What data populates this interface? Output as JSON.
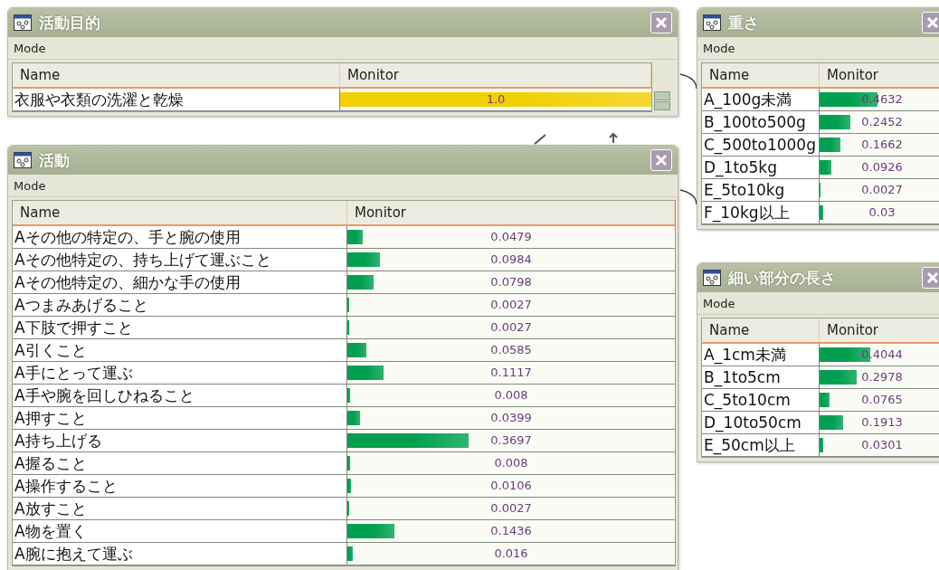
{
  "windows": [
    {
      "title": "活動目的",
      "menu": "Mode",
      "columns": [
        "Name",
        "Monitor"
      ],
      "color": "#f2cf00",
      "scrollbar": true,
      "rows": [
        {
          "name": "衣服や衣類の洗濯と乾燥",
          "value": "1.0",
          "level": 1.0
        }
      ]
    },
    {
      "title": "活動",
      "menu": "Mode",
      "columns": [
        "Name",
        "Monitor"
      ],
      "color": "#00a050",
      "scrollbar": false,
      "rows": [
        {
          "name": "Aその他の特定の、手と腕の使用",
          "value": "0.0479",
          "level": 0.0479
        },
        {
          "name": "Aその他特定の、持ち上げて運ぶこと",
          "value": "0.0984",
          "level": 0.0984
        },
        {
          "name": "Aその他特定の、細かな手の使用",
          "value": "0.0798",
          "level": 0.0798
        },
        {
          "name": "Aつまみあげること",
          "value": "0.0027",
          "level": 0.0027
        },
        {
          "name": "A下肢で押すこと",
          "value": "0.0027",
          "level": 0.0027
        },
        {
          "name": "A引くこと",
          "value": "0.0585",
          "level": 0.0585
        },
        {
          "name": "A手にとって運ぶ",
          "value": "0.1117",
          "level": 0.1117
        },
        {
          "name": "A手や腕を回しひねること",
          "value": "0.008",
          "level": 0.008
        },
        {
          "name": "A押すこと",
          "value": "0.0399",
          "level": 0.0399
        },
        {
          "name": "A持ち上げる",
          "value": "0.3697",
          "level": 0.3697
        },
        {
          "name": "A握ること",
          "value": "0.008",
          "level": 0.008
        },
        {
          "name": "A操作すること",
          "value": "0.0106",
          "level": 0.0106
        },
        {
          "name": "A放すこと",
          "value": "0.0027",
          "level": 0.0027
        },
        {
          "name": "A物を置く",
          "value": "0.1436",
          "level": 0.1436
        },
        {
          "name": "A腕に抱えて運ぶ",
          "value": "0.016",
          "level": 0.016
        }
      ]
    },
    {
      "title": "重さ",
      "menu": "Mode",
      "columns": [
        "Name",
        "Monitor"
      ],
      "color": "#00a050",
      "scrollbar": false,
      "rows": [
        {
          "name": "A_100g未満",
          "value": "0.4632",
          "level": 0.4632
        },
        {
          "name": "B_100to500g",
          "value": "0.2452",
          "level": 0.2452
        },
        {
          "name": "C_500to1000g",
          "value": "0.1662",
          "level": 0.1662
        },
        {
          "name": "D_1to5kg",
          "value": "0.0926",
          "level": 0.0926
        },
        {
          "name": "E_5to10kg",
          "value": "0.0027",
          "level": 0.0027
        },
        {
          "name": "F_10kg以上",
          "value": "0.03",
          "level": 0.03
        }
      ]
    },
    {
      "title": "細い部分の長さ",
      "menu": "Mode",
      "columns": [
        "Name",
        "Monitor"
      ],
      "color": "#00a050",
      "scrollbar": false,
      "rows": [
        {
          "name": "A_1cm未満",
          "value": "0.4044",
          "level": 0.4044
        },
        {
          "name": "B_1to5cm",
          "value": "0.2978",
          "level": 0.2978
        },
        {
          "name": "C_5to10cm",
          "value": "0.0765",
          "level": 0.0765
        },
        {
          "name": "D_10to50cm",
          "value": "0.1913",
          "level": 0.1913
        },
        {
          "name": "E_50cm以上",
          "value": "0.0301",
          "level": 0.0301
        }
      ]
    }
  ]
}
